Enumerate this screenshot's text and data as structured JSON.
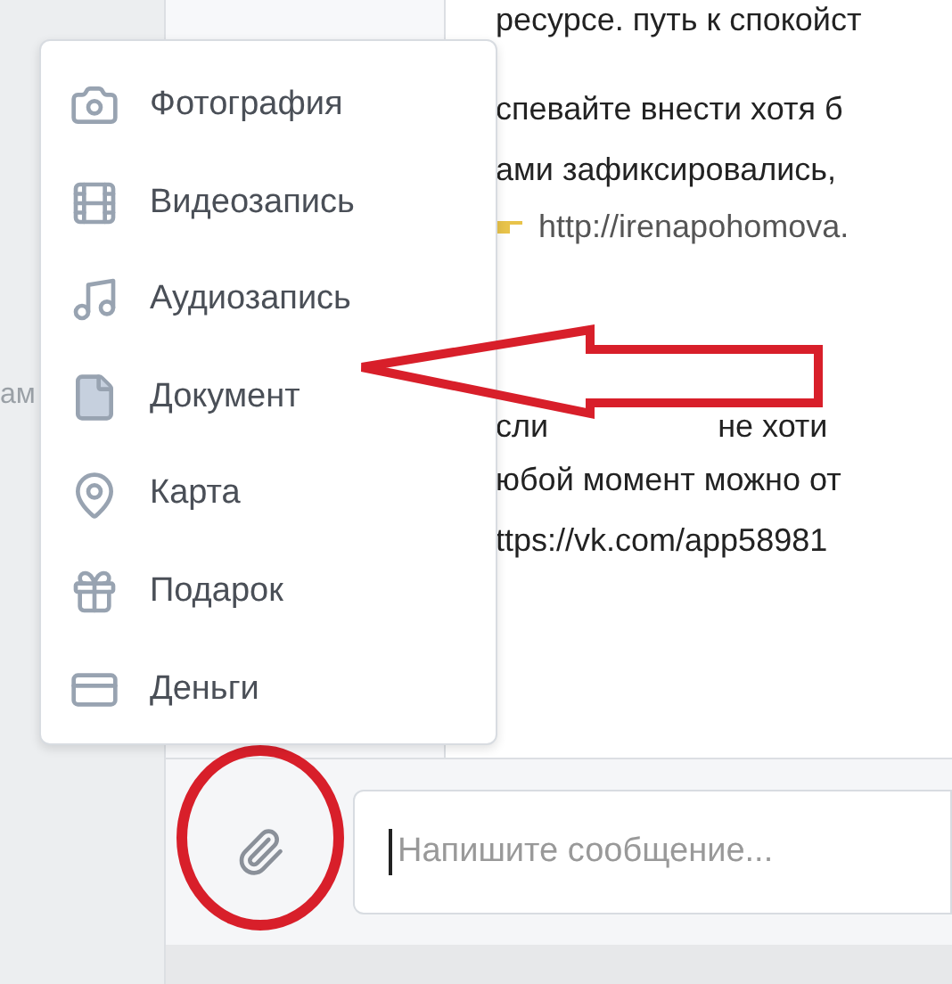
{
  "sidebar_fragment": "ам",
  "messages": [
    {
      "segments": [
        "ресурсе. путь к спокойст"
      ]
    },
    {
      "segments": [
        "спевайте внести хотя б"
      ]
    },
    {
      "segments": [
        "ами зафиксировались,"
      ]
    },
    {
      "kind": "link",
      "segments": [
        "http://irenapohomova."
      ]
    },
    {
      "segments": [
        "сли",
        "не хоти"
      ]
    },
    {
      "segments": [
        "юбой момент можно от"
      ]
    },
    {
      "segments": [
        "ttps://vk.com/app58981"
      ]
    }
  ],
  "menu": {
    "items": [
      {
        "label": "Фотография",
        "kind": "camera",
        "pointed": false
      },
      {
        "label": "Видеозапись",
        "kind": "film",
        "pointed": false
      },
      {
        "label": "Аудиозапись",
        "kind": "music",
        "pointed": false
      },
      {
        "label": "Документ",
        "kind": "document",
        "pointed": true
      },
      {
        "label": "Карта",
        "kind": "pin",
        "pointed": false
      },
      {
        "label": "Подарок",
        "kind": "gift",
        "pointed": false
      },
      {
        "label": "Деньги",
        "kind": "card",
        "pointed": false
      }
    ]
  },
  "composer": {
    "attach_circled": true,
    "placeholder": "Напишите сообщение..."
  }
}
